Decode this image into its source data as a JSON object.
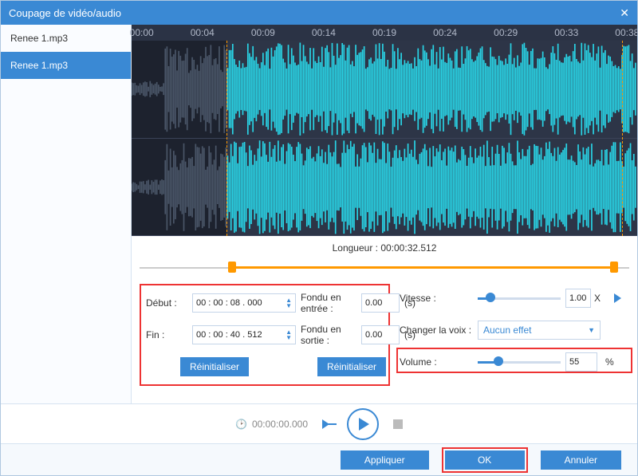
{
  "window": {
    "title": "Coupage de vidéo/audio"
  },
  "sidebar": {
    "files": [
      {
        "name": "Renee 1.mp3"
      },
      {
        "name": "Renee 1.mp3"
      }
    ]
  },
  "timeline": {
    "ticks": [
      "00:00",
      "00:04",
      "00:09",
      "00:14",
      "00:19",
      "00:24",
      "00:29",
      "00:33",
      "00:38"
    ]
  },
  "length": {
    "label": "Longueur : 00:00:32.512"
  },
  "trim": {
    "start_label": "Début :",
    "start_value": "00 : 00 : 08 . 000",
    "end_label": "Fin :",
    "end_value": "00 : 00 : 40 . 512",
    "fadein_label": "Fondu en entrée :",
    "fadein_value": "0.00",
    "fadeout_label": "Fondu en sortie :",
    "fadeout_value": "0.00",
    "seconds_unit": "(s)",
    "reset_label": "Réinitialiser"
  },
  "speed": {
    "label": "Vitesse :",
    "value": "1.00",
    "unit": "X",
    "slider_pct": 15
  },
  "voice": {
    "label": "Changer la voix :",
    "value": "Aucun effet"
  },
  "volume": {
    "label": "Volume :",
    "value": "55",
    "unit": "%",
    "slider_pct": 25
  },
  "playback": {
    "time": "00:00:00.000"
  },
  "footer": {
    "apply": "Appliquer",
    "ok": "OK",
    "cancel": "Annuler"
  }
}
